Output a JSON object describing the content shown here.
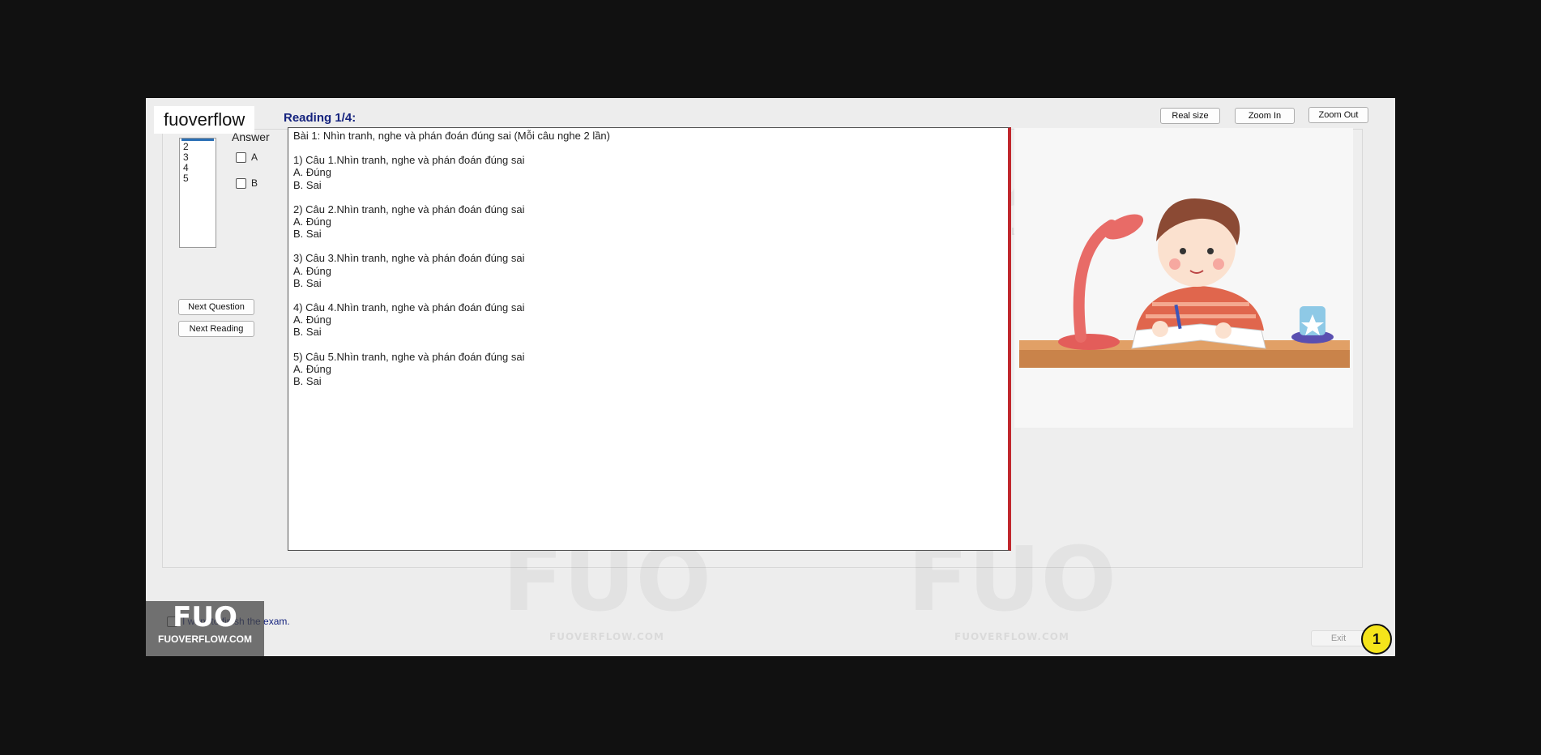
{
  "watermark": {
    "brand_text": "fuoverflow",
    "logo_text": "FUO",
    "site_text": "FUOVERFLOW.COM"
  },
  "left_panel": {
    "question_list": [
      "2",
      "3",
      "4",
      "5"
    ],
    "answer_label": "Answer",
    "options": [
      "A",
      "B"
    ],
    "next_question": "Next Question",
    "next_reading": "Next Reading"
  },
  "reading": {
    "title": "Reading 1/4:",
    "lines": [
      "Bài 1: Nhìn tranh, nghe và phán đoán đúng sai (Mỗi câu nghe 2 lần)",
      "",
      "1) Câu 1.Nhìn tranh, nghe và phán đoán đúng sai",
      "A. Đúng",
      "B. Sai",
      "",
      "2) Câu 2.Nhìn tranh, nghe và phán đoán đúng sai",
      "A. Đúng",
      "B. Sai",
      "",
      "3) Câu 3.Nhìn tranh, nghe và phán đoán đúng sai",
      "A. Đúng",
      "B. Sai",
      "",
      "4) Câu 4.Nhìn tranh, nghe và phán đoán đúng sai",
      "A. Đúng",
      "B. Sai",
      "",
      "5) Câu 5.Nhìn tranh, nghe và phán đoán đúng sai",
      "A. Đúng",
      "B. Sai"
    ]
  },
  "toolbar": {
    "real_size": "Real size",
    "zoom_in": "Zoom In",
    "zoom_out": "Zoom Out"
  },
  "footer": {
    "finish_label": "I want to finish the exam.",
    "exit": "Exit",
    "badge": "1"
  }
}
